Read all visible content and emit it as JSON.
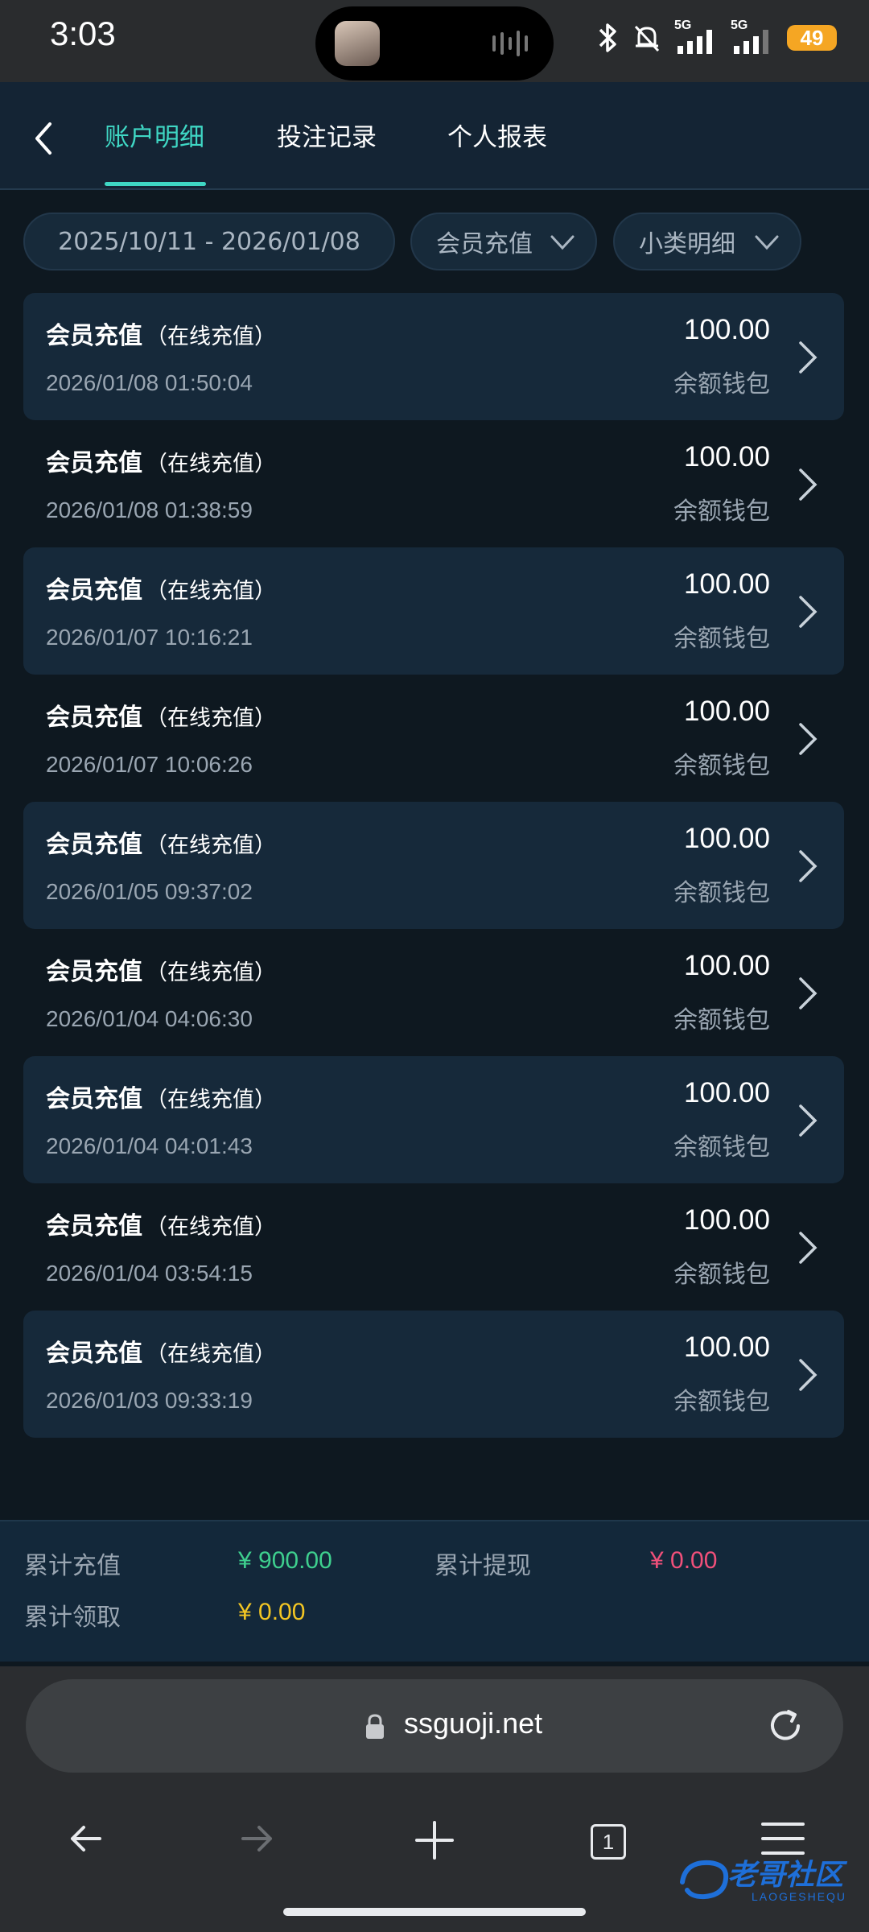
{
  "status_bar": {
    "time": "3:03",
    "battery": "49",
    "signal_label_1": "5G",
    "signal_label_2": "5G",
    "icons": [
      "bluetooth-icon",
      "mute-icon",
      "signal-icon",
      "signal-icon",
      "battery-icon"
    ]
  },
  "header": {
    "tabs": [
      {
        "label": "账户明细",
        "active": true
      },
      {
        "label": "投注记录",
        "active": false
      },
      {
        "label": "个人报表",
        "active": false
      }
    ],
    "accent_color": "#3fd7c4"
  },
  "filters": {
    "date_range": "2025/10/11 - 2026/01/08",
    "category": "会员充值",
    "subcategory": "小类明细"
  },
  "transactions": [
    {
      "title": "会员充值",
      "subtitle": "（在线充值）",
      "time": "2026/01/08 01:50:04",
      "amount": "100.00",
      "wallet": "余额钱包"
    },
    {
      "title": "会员充值",
      "subtitle": "（在线充值）",
      "time": "2026/01/08 01:38:59",
      "amount": "100.00",
      "wallet": "余额钱包"
    },
    {
      "title": "会员充值",
      "subtitle": "（在线充值）",
      "time": "2026/01/07 10:16:21",
      "amount": "100.00",
      "wallet": "余额钱包"
    },
    {
      "title": "会员充值",
      "subtitle": "（在线充值）",
      "time": "2026/01/07 10:06:26",
      "amount": "100.00",
      "wallet": "余额钱包"
    },
    {
      "title": "会员充值",
      "subtitle": "（在线充值）",
      "time": "2026/01/05 09:37:02",
      "amount": "100.00",
      "wallet": "余额钱包"
    },
    {
      "title": "会员充值",
      "subtitle": "（在线充值）",
      "time": "2026/01/04 04:06:30",
      "amount": "100.00",
      "wallet": "余额钱包"
    },
    {
      "title": "会员充值",
      "subtitle": "（在线充值）",
      "time": "2026/01/04 04:01:43",
      "amount": "100.00",
      "wallet": "余额钱包"
    },
    {
      "title": "会员充值",
      "subtitle": "（在线充值）",
      "time": "2026/01/04 03:54:15",
      "amount": "100.00",
      "wallet": "余额钱包"
    },
    {
      "title": "会员充值",
      "subtitle": "（在线充值）",
      "time": "2026/01/03 09:33:19",
      "amount": "100.00",
      "wallet": "余额钱包"
    }
  ],
  "summary": {
    "total_recharge_label": "累计充值",
    "total_recharge_value": "¥ 900.00",
    "total_recharge_color": "#3ecf8e",
    "total_withdraw_label": "累计提现",
    "total_withdraw_value": "¥ 0.00",
    "total_withdraw_color": "#f0507a",
    "total_claim_label": "累计领取",
    "total_claim_value": "¥ 0.00",
    "total_claim_color": "#f3c623"
  },
  "browser": {
    "url": "ssguoji.net",
    "tab_count": "1"
  },
  "watermark": {
    "text": "老哥社区",
    "sub": "LAOGESHEQU"
  }
}
